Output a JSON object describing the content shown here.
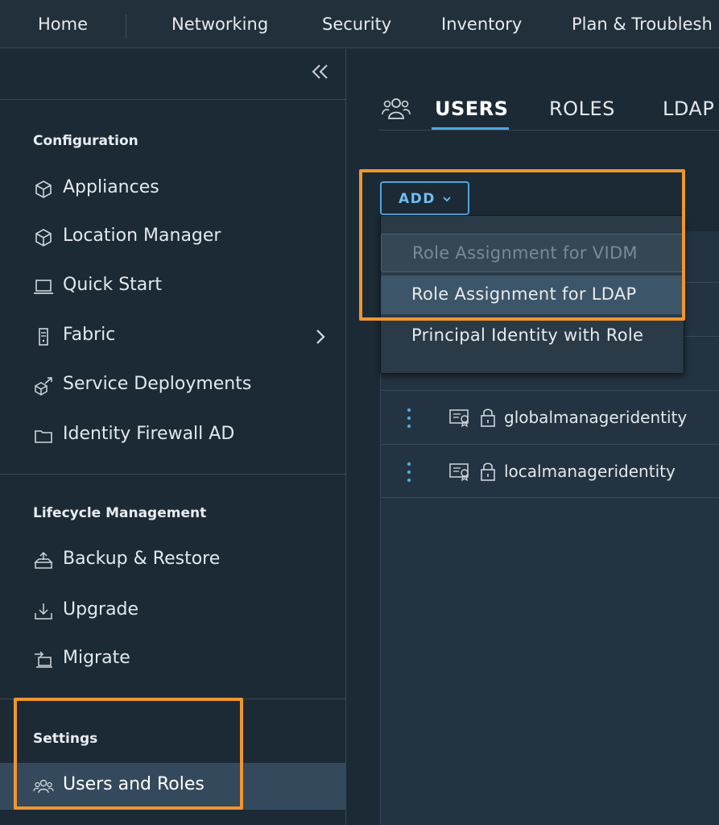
{
  "topnav": {
    "items": [
      "Home",
      "Networking",
      "Security",
      "Inventory",
      "Plan & Troublesh"
    ]
  },
  "sidebar": {
    "sections": [
      {
        "title": "Configuration",
        "items": [
          {
            "label": "Appliances",
            "icon": "cube-icon"
          },
          {
            "label": "Location Manager",
            "icon": "cube-icon"
          },
          {
            "label": "Quick Start",
            "icon": "laptop-icon"
          },
          {
            "label": "Fabric",
            "icon": "server-icon"
          },
          {
            "label": "Service Deployments",
            "icon": "service-icon"
          },
          {
            "label": "Identity Firewall AD",
            "icon": "folder-icon"
          }
        ]
      },
      {
        "title": "Lifecycle Management",
        "items": [
          {
            "label": "Backup & Restore",
            "icon": "backup-icon"
          },
          {
            "label": "Upgrade",
            "icon": "upgrade-icon"
          },
          {
            "label": "Migrate",
            "icon": "migrate-icon"
          }
        ]
      },
      {
        "title": "Settings",
        "items": [
          {
            "label": "Users and Roles",
            "icon": "users-icon"
          }
        ]
      }
    ]
  },
  "main": {
    "tabs": [
      "USERS",
      "ROLES",
      "LDAP"
    ],
    "active_tab": "USERS",
    "add_button": "ADD",
    "dropdown": [
      {
        "label": "Role Assignment for VIDM",
        "state": "disabled"
      },
      {
        "label": "Role Assignment for LDAP",
        "state": "hover"
      },
      {
        "label": "Principal Identity with Role",
        "state": "normal"
      }
    ],
    "rows": [
      "globalmanageridentity",
      "localmanageridentity"
    ]
  },
  "colors": {
    "accent": "#4ea7de",
    "highlight": "#f0962f",
    "active_item_bg": "#344a5c"
  }
}
